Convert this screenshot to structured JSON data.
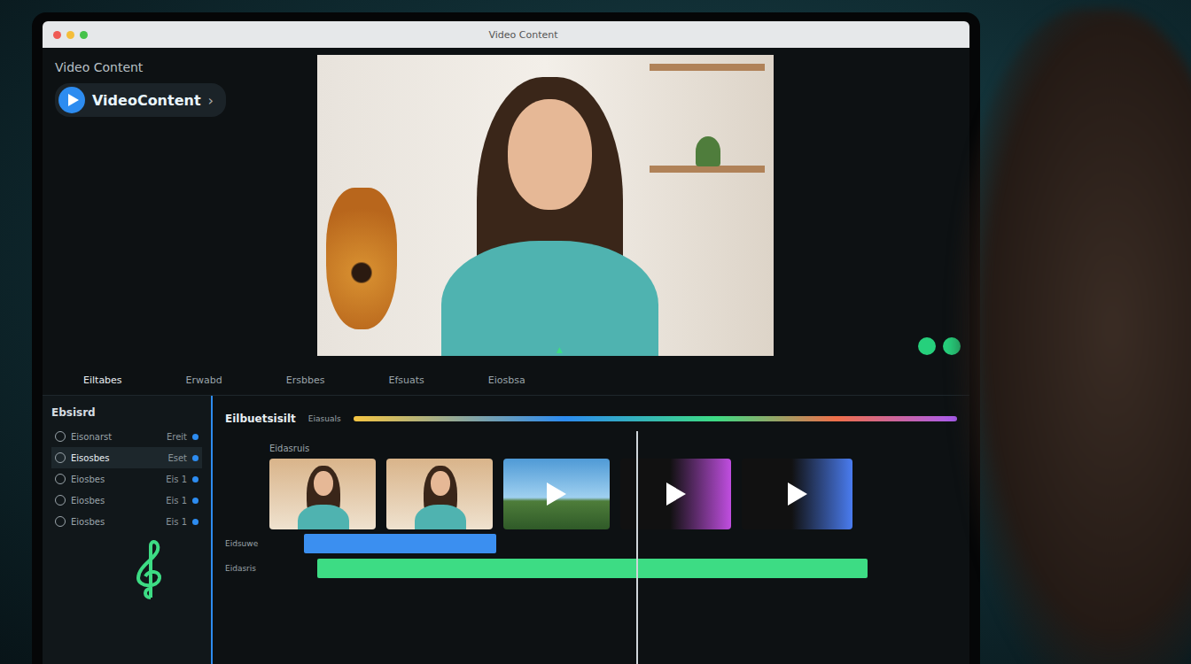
{
  "window": {
    "title": "Video Content"
  },
  "app": {
    "name": "Video Content",
    "logo": "VideoContent",
    "logo_arrow": "›"
  },
  "preview": {
    "caption": "▲"
  },
  "toolbar": [
    {
      "label": "Eiltabes",
      "selected": true
    },
    {
      "label": "Erwabd",
      "selected": false
    },
    {
      "label": "Ersbbes",
      "selected": false
    },
    {
      "label": "Efsuats",
      "selected": false
    },
    {
      "label": "Eiosbsa",
      "selected": false
    }
  ],
  "sidebar": {
    "title": "Ebsisrd",
    "items": [
      {
        "label": "Eisonarst",
        "value": "Ereit",
        "selected": false
      },
      {
        "label": "Eisosbes",
        "value": "Eset",
        "selected": true
      },
      {
        "label": "Eiosbes",
        "value": "Eis 1",
        "selected": false
      },
      {
        "label": "Eiosbes",
        "value": "Eis 1",
        "selected": false
      },
      {
        "label": "Eiosbes",
        "value": "Eis 1",
        "selected": false
      }
    ]
  },
  "timeline": {
    "title": "Eilbuetsisilt",
    "ruler_label": "Eiasuals",
    "track_label": "Eidasruis",
    "clips": [
      {
        "kind": "photo",
        "color": "#d9b48a"
      },
      {
        "kind": "photo",
        "color": "#d9b48a"
      },
      {
        "kind": "landscape",
        "color": "#4f9ad6"
      },
      {
        "kind": "play",
        "color": "#c04ee0"
      },
      {
        "kind": "play",
        "color": "#4a7cf0"
      }
    ],
    "tracks": [
      {
        "label": "Eidsuwe",
        "color": "#3b8ff0"
      },
      {
        "label": "Eidasris",
        "color": "#3ddc84"
      }
    ]
  }
}
